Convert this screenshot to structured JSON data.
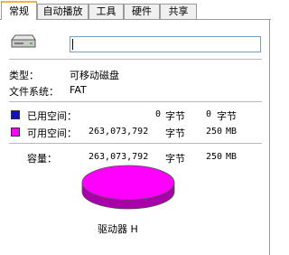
{
  "tabs": [
    {
      "label": "常规",
      "active": true
    },
    {
      "label": "自动播放",
      "active": false
    },
    {
      "label": "工具",
      "active": false
    },
    {
      "label": "硬件",
      "active": false
    },
    {
      "label": "共享",
      "active": false
    }
  ],
  "drive": {
    "icon": "removable-drive-icon",
    "name_value": ""
  },
  "info": {
    "type_label": "类型：",
    "type_value": "可移动磁盘",
    "fs_label": "文件系统：",
    "fs_value": "FAT"
  },
  "space": {
    "used": {
      "label": "已用空间：",
      "color": "#1010c8",
      "bytes": "0",
      "bytes_unit": "字节",
      "size": "0",
      "size_unit": "字节"
    },
    "free": {
      "label": "可用空间：",
      "color": "#ff00ff",
      "bytes": "263,073,792",
      "bytes_unit": "字节",
      "size": "250",
      "size_unit": "MB"
    },
    "capacity": {
      "label": "容量：",
      "bytes": "263,073,792",
      "bytes_unit": "字节",
      "size": "250",
      "size_unit": "MB"
    }
  },
  "pie": {
    "used_fraction": 0,
    "free_color": "#ff00ff",
    "free_side_color": "#a800a8"
  },
  "drive_label": "驱动器 H"
}
